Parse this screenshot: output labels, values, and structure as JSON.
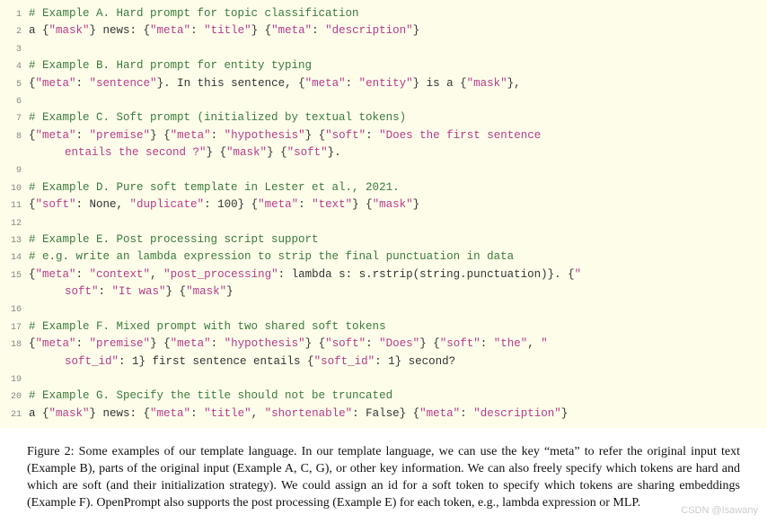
{
  "code": {
    "l1_comment": "# Example A. Hard prompt for topic classification",
    "l2_a": "a {",
    "l2_mask": "\"mask\"",
    "l2_b": "} news: {",
    "l2_meta1": "\"meta\"",
    "l2_c": ": ",
    "l2_title": "\"title\"",
    "l2_d": "} {",
    "l2_meta2": "\"meta\"",
    "l2_e": ": ",
    "l2_desc": "\"description\"",
    "l2_f": "}",
    "l4_comment": "# Example B. Hard prompt for entity typing",
    "l5_a": "{",
    "l5_meta1": "\"meta\"",
    "l5_b": ": ",
    "l5_sent": "\"sentence\"",
    "l5_c": "}. In this sentence, {",
    "l5_meta2": "\"meta\"",
    "l5_d": ": ",
    "l5_ent": "\"entity\"",
    "l5_e": "} is a {",
    "l5_mask": "\"mask\"",
    "l5_f": "},",
    "l7_comment": "# Example C. Soft prompt (initialized by textual tokens)",
    "l8_a": "{",
    "l8_meta1": "\"meta\"",
    "l8_b": ": ",
    "l8_prem": "\"premise\"",
    "l8_c": "} {",
    "l8_meta2": "\"meta\"",
    "l8_d": ": ",
    "l8_hyp": "\"hypothesis\"",
    "l8_e": "} {",
    "l8_soft": "\"soft\"",
    "l8_f": ": ",
    "l8_q": "\"Does the first sentence ",
    "l8cont_q": "entails the second ?\"",
    "l8cont_a": "} {",
    "l8cont_mask": "\"mask\"",
    "l8cont_b": "} {",
    "l8cont_soft": "\"soft\"",
    "l8cont_c": "}.",
    "l10_comment": "# Example D. Pure soft template in Lester et al., 2021.",
    "l11_a": "{",
    "l11_soft": "\"soft\"",
    "l11_b": ": None, ",
    "l11_dup": "\"duplicate\"",
    "l11_c": ": 100} {",
    "l11_meta": "\"meta\"",
    "l11_d": ": ",
    "l11_text": "\"text\"",
    "l11_e": "} {",
    "l11_mask": "\"mask\"",
    "l11_f": "}",
    "l13_comment": "# Example E. Post processing script support",
    "l14_comment": "# e.g. write an lambda expression to strip the final punctuation in data",
    "l15_a": "{",
    "l15_meta": "\"meta\"",
    "l15_b": ": ",
    "l15_ctx": "\"context\"",
    "l15_c": ", ",
    "l15_pp": "\"post_processing\"",
    "l15_d": ": lambda s: s.rstrip(string.punctuation)}. {",
    "l15_q": "\"",
    "l15cont_soft": "soft\"",
    "l15cont_a": ": ",
    "l15cont_itwas": "\"It was\"",
    "l15cont_b": "} {",
    "l15cont_mask": "\"mask\"",
    "l15cont_c": "}",
    "l17_comment": "# Example F. Mixed prompt with two shared soft tokens",
    "l18_a": "{",
    "l18_meta1": "\"meta\"",
    "l18_b": ": ",
    "l18_prem": "\"premise\"",
    "l18_c": "} {",
    "l18_meta2": "\"meta\"",
    "l18_d": ": ",
    "l18_hyp": "\"hypothesis\"",
    "l18_e": "} {",
    "l18_soft1": "\"soft\"",
    "l18_f": ": ",
    "l18_does": "\"Does\"",
    "l18_g": "} {",
    "l18_soft2": "\"soft\"",
    "l18_h": ": ",
    "l18_the": "\"the\"",
    "l18_i": ", ",
    "l18_q": "\"",
    "l18cont_sid": "soft_id\"",
    "l18cont_a": ": 1} first sentence entails {",
    "l18cont_sid2": "\"soft_id\"",
    "l18cont_b": ": 1} second?",
    "l20_comment": "# Example G. Specify the title should not be truncated",
    "l21_a": "a {",
    "l21_mask": "\"mask\"",
    "l21_b": "} news: {",
    "l21_meta1": "\"meta\"",
    "l21_c": ": ",
    "l21_title": "\"title\"",
    "l21_d": ", ",
    "l21_short": "\"shortenable\"",
    "l21_e": ": False} {",
    "l21_meta2": "\"meta\"",
    "l21_f": ": ",
    "l21_desc": "\"description\"",
    "l21_g": "}"
  },
  "caption": "Figure 2: Some examples of our template language. In our template language, we can use the key “meta” to refer the original input text (Example B), parts of the original input (Example A, C, G), or other key information. We can also freely specify which tokens are hard and which are soft (and their initialization strategy). We could assign an id for a soft token to specify which tokens are sharing embeddings (Example F). OpenPrompt also supports the post processing (Example E) for each token, e.g., lambda expression or MLP.",
  "watermark": "CSDN @Isawany",
  "linenums": {
    "n1": "1",
    "n2": "2",
    "n3": "3",
    "n4": "4",
    "n5": "5",
    "n6": "6",
    "n7": "7",
    "n8": "8",
    "n9": "9",
    "n10": "10",
    "n11": "11",
    "n12": "12",
    "n13": "13",
    "n14": "14",
    "n15": "15",
    "n16": "16",
    "n17": "17",
    "n18": "18",
    "n19": "19",
    "n20": "20",
    "n21": "21"
  }
}
